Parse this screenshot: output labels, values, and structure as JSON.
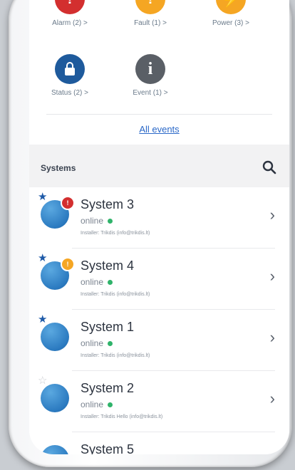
{
  "events": [
    {
      "label": "Alarm (2) >",
      "color": "#d32f2f",
      "icon": "siren-icon",
      "glyph": "!"
    },
    {
      "label": "Fault (1) >",
      "color": "#f5a623",
      "icon": "warning-icon",
      "glyph": "!"
    },
    {
      "label": "Power (3) >",
      "color": "#f5a623",
      "icon": "power-icon",
      "glyph": "⚡"
    },
    {
      "label": "Status (2) >",
      "color": "#1e5a9c",
      "icon": "lock-icon",
      "glyph": "🔒"
    },
    {
      "label": "Event (1) >",
      "color": "#5a5f66",
      "icon": "info-icon",
      "glyph": "i"
    }
  ],
  "all_events_link": "All events",
  "systems_header": "Systems",
  "systems": [
    {
      "name": "System 3",
      "status": "online",
      "installer": "Installer: Trikdis (info@trikdis.lt)",
      "favorite": true,
      "badge": "alarm",
      "badge_color": "#d32f2f"
    },
    {
      "name": "System 4",
      "status": "online",
      "installer": "Installer: Trikdis (info@trikdis.lt)",
      "favorite": true,
      "badge": "warning",
      "badge_color": "#f5a623"
    },
    {
      "name": "System 1",
      "status": "online",
      "installer": "Installer: Trikdis (info@trikdis.lt)",
      "favorite": true,
      "badge": "",
      "badge_color": ""
    },
    {
      "name": "System 2",
      "status": "online",
      "installer": "Installer: Trikdis Hello (info@trikdis.lt)",
      "favorite": false,
      "badge": "",
      "badge_color": ""
    },
    {
      "name": "System 5",
      "status": "",
      "installer": "",
      "favorite": false,
      "badge": "",
      "badge_color": ""
    }
  ],
  "colors": {
    "accent": "#2a68c8",
    "online": "#2fb36a",
    "star": "#1e5aa8"
  }
}
